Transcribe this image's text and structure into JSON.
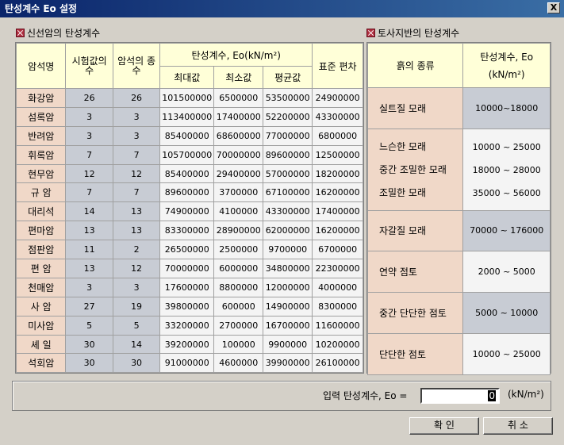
{
  "window": {
    "title": "탄성계수 Eo 설정",
    "close_label": "X"
  },
  "rock": {
    "section_title": "신선암의 탄성계수",
    "headers": {
      "name": "암석명",
      "test_count": "시험값의 수",
      "type_count": "암석의 종수",
      "modulus": "탄성계수, Eo(kN/m²)",
      "max": "최대값",
      "min": "최소값",
      "avg": "평균값",
      "std": "표준 편차"
    },
    "rows": [
      {
        "name": "화강암",
        "test": "26",
        "types": "26",
        "max": "101500000",
        "min": "6500000",
        "avg": "53500000",
        "std": "24900000"
      },
      {
        "name": "섬록암",
        "test": "3",
        "types": "3",
        "max": "113400000",
        "min": "17400000",
        "avg": "52200000",
        "std": "43300000"
      },
      {
        "name": "반려암",
        "test": "3",
        "types": "3",
        "max": "85400000",
        "min": "68600000",
        "avg": "77000000",
        "std": "6800000"
      },
      {
        "name": "휘록암",
        "test": "7",
        "types": "7",
        "max": "105700000",
        "min": "70000000",
        "avg": "89600000",
        "std": "12500000"
      },
      {
        "name": "현무암",
        "test": "12",
        "types": "12",
        "max": "85400000",
        "min": "29400000",
        "avg": "57000000",
        "std": "18200000"
      },
      {
        "name": "규  암",
        "test": "7",
        "types": "7",
        "max": "89600000",
        "min": "3700000",
        "avg": "67100000",
        "std": "16200000"
      },
      {
        "name": "대리석",
        "test": "14",
        "types": "13",
        "max": "74900000",
        "min": "4100000",
        "avg": "43300000",
        "std": "17400000"
      },
      {
        "name": "편마암",
        "test": "13",
        "types": "13",
        "max": "83300000",
        "min": "28900000",
        "avg": "62000000",
        "std": "16200000"
      },
      {
        "name": "점판암",
        "test": "11",
        "types": "2",
        "max": "26500000",
        "min": "2500000",
        "avg": "9700000",
        "std": "6700000"
      },
      {
        "name": "편  암",
        "test": "13",
        "types": "12",
        "max": "70000000",
        "min": "6000000",
        "avg": "34800000",
        "std": "22300000"
      },
      {
        "name": "천매암",
        "test": "3",
        "types": "3",
        "max": "17600000",
        "min": "8800000",
        "avg": "12000000",
        "std": "4000000"
      },
      {
        "name": "사  암",
        "test": "27",
        "types": "19",
        "max": "39800000",
        "min": "600000",
        "avg": "14900000",
        "std": "8300000"
      },
      {
        "name": "미사암",
        "test": "5",
        "types": "5",
        "max": "33200000",
        "min": "2700000",
        "avg": "16700000",
        "std": "11600000"
      },
      {
        "name": "셰  일",
        "test": "30",
        "types": "14",
        "max": "39200000",
        "min": "100000",
        "avg": "9900000",
        "std": "10200000"
      },
      {
        "name": "석회암",
        "test": "30",
        "types": "30",
        "max": "91000000",
        "min": "4600000",
        "avg": "39900000",
        "std": "26100000"
      }
    ]
  },
  "soil": {
    "section_title": "토사지반의 탄성계수",
    "headers": {
      "type": "흙의 종류",
      "modulus": "탄성계수, Eo",
      "unit": "(kN/m²)"
    },
    "rows": [
      {
        "names": [
          "실트질 모래"
        ],
        "values": [
          "10000~18000"
        ]
      },
      {
        "names": [
          "느슨한 모래",
          "중간 조밀한 모래",
          "조밀한 모래"
        ],
        "values": [
          "10000 ~ 25000",
          "18000 ~ 28000",
          "35000 ~ 56000"
        ]
      },
      {
        "names": [
          "자갈질 모래"
        ],
        "values": [
          "70000 ~ 176000"
        ]
      },
      {
        "names": [
          "연약 점토"
        ],
        "values": [
          "2000 ~ 5000"
        ]
      },
      {
        "names": [
          "중간 단단한 점토"
        ],
        "values": [
          "5000 ~ 10000"
        ]
      },
      {
        "names": [
          "단단한 점토"
        ],
        "values": [
          "10000 ~ 25000"
        ]
      }
    ]
  },
  "input": {
    "label": "입력 탄성계수, Eo =",
    "value": "0",
    "unit": "(kN/m²)"
  },
  "buttons": {
    "ok": "확 인",
    "cancel": "취 소"
  }
}
